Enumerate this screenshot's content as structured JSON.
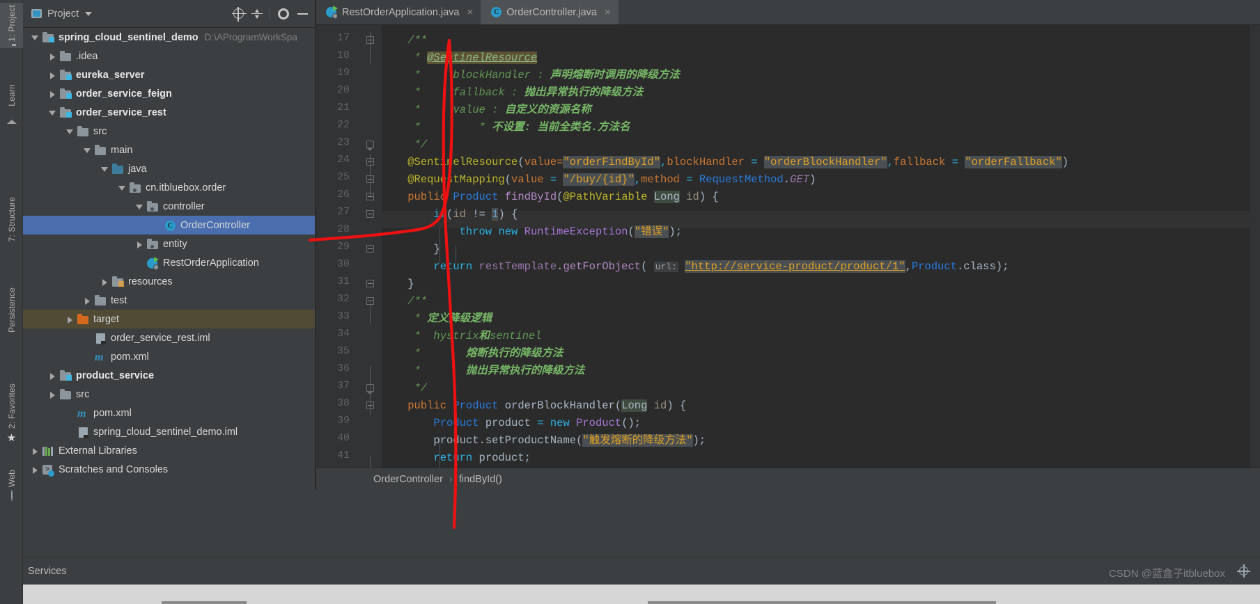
{
  "toolwindow_left": [
    {
      "label": "1: Project",
      "icon": "folder-icon",
      "active": true
    },
    {
      "label": "Learn",
      "icon": "layers-icon",
      "active": false
    },
    {
      "label": "7: Structure",
      "icon": "structure-icon",
      "active": false
    },
    {
      "label": "Persistence",
      "icon": "database-icon",
      "active": false
    },
    {
      "label": "2: Favorites",
      "icon": "star-icon",
      "active": false
    },
    {
      "label": "Web",
      "icon": "globe-icon",
      "active": false
    }
  ],
  "project_header": {
    "title": "Project",
    "caret": "chevron-down-icon",
    "buttons": [
      {
        "name": "scroll-from-source-button",
        "icon": "target-icon"
      },
      {
        "name": "collapse-all-button",
        "icon": "collapse-all-icon"
      },
      {
        "name": "settings-button",
        "icon": "gear-icon"
      },
      {
        "name": "hide-button",
        "icon": "minimize-icon"
      }
    ]
  },
  "tree": [
    {
      "indent": 0,
      "arrow": "open",
      "icon": "module-folder-icon",
      "label": "spring_cloud_sentinel_demo",
      "bold": true,
      "path": "D:\\AProgramWorkSpa",
      "state": "normal"
    },
    {
      "indent": 1,
      "arrow": "closed",
      "icon": "folder-icon",
      "label": ".idea",
      "bold": false,
      "path": "",
      "state": "normal"
    },
    {
      "indent": 1,
      "arrow": "closed",
      "icon": "module-folder-icon",
      "label": "eureka_server",
      "bold": true,
      "path": "",
      "state": "normal"
    },
    {
      "indent": 1,
      "arrow": "closed",
      "icon": "module-folder-icon",
      "label": "order_service_feign",
      "bold": true,
      "path": "",
      "state": "normal"
    },
    {
      "indent": 1,
      "arrow": "open",
      "icon": "module-folder-icon",
      "label": "order_service_rest",
      "bold": true,
      "path": "",
      "state": "normal"
    },
    {
      "indent": 2,
      "arrow": "open",
      "icon": "folder-icon",
      "label": "src",
      "bold": false,
      "path": "",
      "state": "normal"
    },
    {
      "indent": 3,
      "arrow": "open",
      "icon": "folder-icon",
      "label": "main",
      "bold": false,
      "path": "",
      "state": "normal"
    },
    {
      "indent": 4,
      "arrow": "open",
      "icon": "source-folder-icon",
      "label": "java",
      "bold": false,
      "path": "",
      "state": "normal"
    },
    {
      "indent": 5,
      "arrow": "open",
      "icon": "package-icon",
      "label": "cn.itbluebox.order",
      "bold": false,
      "path": "",
      "state": "normal"
    },
    {
      "indent": 6,
      "arrow": "open",
      "icon": "package-icon",
      "label": "controller",
      "bold": false,
      "path": "",
      "state": "normal"
    },
    {
      "indent": 7,
      "arrow": "none",
      "icon": "java-class-icon",
      "label": "OrderController",
      "bold": false,
      "path": "",
      "state": "selected"
    },
    {
      "indent": 6,
      "arrow": "closed",
      "icon": "package-icon",
      "label": "entity",
      "bold": false,
      "path": "",
      "state": "normal"
    },
    {
      "indent": 6,
      "arrow": "none",
      "icon": "spring-boot-icon",
      "label": "RestOrderApplication",
      "bold": false,
      "path": "",
      "state": "normal"
    },
    {
      "indent": 4,
      "arrow": "closed",
      "icon": "resources-folder-icon",
      "label": "resources",
      "bold": false,
      "path": "",
      "state": "normal"
    },
    {
      "indent": 3,
      "arrow": "closed",
      "icon": "folder-icon",
      "label": "test",
      "bold": false,
      "path": "",
      "state": "normal"
    },
    {
      "indent": 2,
      "arrow": "closed",
      "icon": "target-folder-icon",
      "label": "target",
      "bold": false,
      "path": "",
      "state": "highlight"
    },
    {
      "indent": 3,
      "arrow": "none",
      "icon": "iml-file-icon",
      "label": "order_service_rest.iml",
      "bold": false,
      "path": "",
      "state": "normal"
    },
    {
      "indent": 3,
      "arrow": "none",
      "icon": "maven-icon",
      "label": "pom.xml",
      "bold": false,
      "path": "",
      "state": "normal"
    },
    {
      "indent": 1,
      "arrow": "closed",
      "icon": "module-folder-icon",
      "label": "product_service",
      "bold": true,
      "path": "",
      "state": "normal"
    },
    {
      "indent": 1,
      "arrow": "closed",
      "icon": "folder-icon",
      "label": "src",
      "bold": false,
      "path": "",
      "state": "normal"
    },
    {
      "indent": 2,
      "arrow": "none",
      "icon": "maven-icon",
      "label": "pom.xml",
      "bold": false,
      "path": "",
      "state": "normal"
    },
    {
      "indent": 2,
      "arrow": "none",
      "icon": "iml-file-icon",
      "label": "spring_cloud_sentinel_demo.iml",
      "bold": false,
      "path": "",
      "state": "normal"
    },
    {
      "indent": 0,
      "arrow": "closed",
      "icon": "library-icon",
      "label": "External Libraries",
      "bold": false,
      "path": "",
      "state": "normal"
    },
    {
      "indent": 0,
      "arrow": "closed",
      "icon": "scratches-icon",
      "label": "Scratches and Consoles",
      "bold": false,
      "path": "",
      "state": "normal"
    }
  ],
  "editor_tabs": [
    {
      "label": "RestOrderApplication.java",
      "icon": "spring-boot-icon",
      "active": false,
      "close": "×"
    },
    {
      "label": "OrderController.java",
      "icon": "java-class-icon",
      "active": true,
      "close": "×"
    }
  ],
  "code": {
    "first_line_number": 17,
    "lines": [
      {
        "n": 17,
        "fold": "start",
        "tokens": [
          {
            "t": "    /**",
            "c": "c-cmt"
          }
        ]
      },
      {
        "n": 18,
        "fold": "",
        "tokens": [
          {
            "t": "     * ",
            "c": "c-cmt"
          },
          {
            "t": "@SentinelResource",
            "c": "c-tag"
          }
        ]
      },
      {
        "n": 19,
        "fold": "",
        "tokens": [
          {
            "t": "     *     ",
            "c": "c-cmt"
          },
          {
            "t": "blockHandler : ",
            "c": "c-cmt"
          },
          {
            "t": "声明熔断时调用的降级方法",
            "c": "c-cmtb"
          }
        ]
      },
      {
        "n": 20,
        "fold": "",
        "tokens": [
          {
            "t": "     *     ",
            "c": "c-cmt"
          },
          {
            "t": "fallback : ",
            "c": "c-cmt"
          },
          {
            "t": "抛出异常执行的降级方法",
            "c": "c-cmtb"
          }
        ]
      },
      {
        "n": 21,
        "fold": "",
        "tokens": [
          {
            "t": "     *     ",
            "c": "c-cmt"
          },
          {
            "t": "value : ",
            "c": "c-cmt"
          },
          {
            "t": "自定义的资源名称",
            "c": "c-cmtb"
          }
        ]
      },
      {
        "n": 22,
        "fold": "",
        "tokens": [
          {
            "t": "     *         * ",
            "c": "c-cmt"
          },
          {
            "t": "不设置: 当前全类名.方法名",
            "c": "c-cmtb"
          }
        ]
      },
      {
        "n": 23,
        "fold": "end",
        "tokens": [
          {
            "t": "     */",
            "c": "c-cmt"
          }
        ]
      },
      {
        "n": 24,
        "fold": "mark",
        "tokens": [
          {
            "t": "    @SentinelResource",
            "c": "c-anno"
          },
          {
            "t": "(",
            "c": "c-plain"
          },
          {
            "t": "value=",
            "c": "c-kw"
          },
          {
            "t": "\"orderFindById\"",
            "c": "c-strhl"
          },
          {
            "t": ",",
            "c": "c-eq"
          },
          {
            "t": "blockHandler ",
            "c": "c-kw"
          },
          {
            "t": "= ",
            "c": "c-eq"
          },
          {
            "t": "\"orderBlockHandler\"",
            "c": "c-strhl"
          },
          {
            "t": ",",
            "c": "c-eq"
          },
          {
            "t": "fallback ",
            "c": "c-kw"
          },
          {
            "t": "= ",
            "c": "c-eq"
          },
          {
            "t": "\"orderFallback\"",
            "c": "c-strhl"
          },
          {
            "t": ")",
            "c": "c-plain"
          }
        ]
      },
      {
        "n": 25,
        "fold": "mark",
        "tokens": [
          {
            "t": "    @RequestMapping",
            "c": "c-anno"
          },
          {
            "t": "(",
            "c": "c-plain"
          },
          {
            "t": "value ",
            "c": "c-kw"
          },
          {
            "t": "= ",
            "c": "c-eq"
          },
          {
            "t": "\"/buy/{id}\"",
            "c": "c-strhl"
          },
          {
            "t": ",",
            "c": "c-eq"
          },
          {
            "t": "method ",
            "c": "c-kw"
          },
          {
            "t": "= ",
            "c": "c-eq"
          },
          {
            "t": "RequestMethod",
            "c": "c-type"
          },
          {
            "t": ".",
            "c": "c-plain"
          },
          {
            "t": "GET",
            "c": "c-static"
          },
          {
            "t": ")",
            "c": "c-plain"
          }
        ]
      },
      {
        "n": 26,
        "fold": "mark",
        "current": true,
        "tokens": [
          {
            "t": "    public ",
            "c": "c-kw"
          },
          {
            "t": "Product ",
            "c": "c-type"
          },
          {
            "t": "findById",
            "c": "c-meth"
          },
          {
            "t": "(",
            "c": "c-plain"
          },
          {
            "t": "@PathVariable ",
            "c": "c-anno"
          },
          {
            "t": "Long",
            "c": "c-longhl"
          },
          {
            "t": " ",
            "c": "c-plain"
          },
          {
            "t": "id",
            "c": "c-param"
          },
          {
            "t": ") {",
            "c": "c-plain"
          }
        ]
      },
      {
        "n": 27,
        "fold": "mark",
        "tokens": [
          {
            "t": "        if",
            "c": "c-kw2"
          },
          {
            "t": "(",
            "c": "c-plain"
          },
          {
            "t": "id",
            "c": "c-param"
          },
          {
            "t": " != ",
            "c": "c-plain"
          },
          {
            "t": "1",
            "c": "c-num"
          },
          {
            "t": ") {",
            "c": "c-plain"
          }
        ]
      },
      {
        "n": 28,
        "fold": "",
        "tokens": [
          {
            "t": "            throw ",
            "c": "c-kw2"
          },
          {
            "t": "new ",
            "c": "c-kw2"
          },
          {
            "t": "RuntimeException",
            "c": "c-typep"
          },
          {
            "t": "(",
            "c": "c-plain"
          },
          {
            "t": "\"错误\"",
            "c": "c-strhl"
          },
          {
            "t": ");",
            "c": "c-plain"
          }
        ]
      },
      {
        "n": 29,
        "fold": "mark",
        "tokens": [
          {
            "t": "        }",
            "c": "c-plain"
          }
        ]
      },
      {
        "n": 30,
        "fold": "",
        "tokens": [
          {
            "t": "        return ",
            "c": "c-kw2"
          },
          {
            "t": "restTemplate",
            "c": "c-field"
          },
          {
            "t": ".",
            "c": "c-plain"
          },
          {
            "t": "getForObject",
            "c": "c-meth"
          },
          {
            "t": "( ",
            "c": "c-plain"
          },
          {
            "t": "url:",
            "c": "c-hintbg"
          },
          {
            "t": " ",
            "c": "c-plain"
          },
          {
            "t": "\"http://service-product/product/1\"",
            "c": "c-url"
          },
          {
            "t": ",",
            "c": "c-plain"
          },
          {
            "t": "Product",
            "c": "c-type"
          },
          {
            "t": ".",
            "c": "c-plain"
          },
          {
            "t": "class",
            "c": "c-plain"
          },
          {
            "t": ");",
            "c": "c-plain"
          }
        ]
      },
      {
        "n": 31,
        "fold": "mark",
        "tokens": [
          {
            "t": "    }",
            "c": "c-plain"
          }
        ]
      },
      {
        "n": 32,
        "fold": "start",
        "tokens": [
          {
            "t": "    /**",
            "c": "c-cmt"
          }
        ]
      },
      {
        "n": 33,
        "fold": "",
        "tokens": [
          {
            "t": "     * ",
            "c": "c-cmt"
          },
          {
            "t": "定义降级逻辑",
            "c": "c-cmtb"
          }
        ]
      },
      {
        "n": 34,
        "fold": "",
        "tokens": [
          {
            "t": "     *  ",
            "c": "c-cmt"
          },
          {
            "t": "hystrix",
            "c": "c-cmt"
          },
          {
            "t": "和",
            "c": "c-cmtb"
          },
          {
            "t": "sentinel",
            "c": "c-cmt"
          }
        ]
      },
      {
        "n": 35,
        "fold": "",
        "tokens": [
          {
            "t": "     *       ",
            "c": "c-cmt"
          },
          {
            "t": "熔断执行的降级方法",
            "c": "c-cmtb"
          }
        ]
      },
      {
        "n": 36,
        "fold": "",
        "tokens": [
          {
            "t": "     *       ",
            "c": "c-cmt"
          },
          {
            "t": "抛出异常执行的降级方法",
            "c": "c-cmtb"
          }
        ]
      },
      {
        "n": 37,
        "fold": "end",
        "tokens": [
          {
            "t": "     */",
            "c": "c-cmt"
          }
        ]
      },
      {
        "n": 38,
        "fold": "mark",
        "tokens": [
          {
            "t": "    public ",
            "c": "c-kw"
          },
          {
            "t": "Product ",
            "c": "c-type"
          },
          {
            "t": "orderBlockHandler",
            "c": "c-plain"
          },
          {
            "t": "(",
            "c": "c-plain"
          },
          {
            "t": "Long",
            "c": "c-longhl"
          },
          {
            "t": " ",
            "c": "c-plain"
          },
          {
            "t": "id",
            "c": "c-param"
          },
          {
            "t": ") {",
            "c": "c-plain"
          }
        ]
      },
      {
        "n": 39,
        "fold": "",
        "tokens": [
          {
            "t": "        Product ",
            "c": "c-type"
          },
          {
            "t": "product ",
            "c": "c-plain"
          },
          {
            "t": "= ",
            "c": "c-eq"
          },
          {
            "t": "new ",
            "c": "c-kw2"
          },
          {
            "t": "Product",
            "c": "c-typep"
          },
          {
            "t": "();",
            "c": "c-plain"
          }
        ]
      },
      {
        "n": 40,
        "fold": "",
        "tokens": [
          {
            "t": "        product",
            "c": "c-plain"
          },
          {
            "t": ".",
            "c": "c-plain"
          },
          {
            "t": "setProductName",
            "c": "c-plain"
          },
          {
            "t": "(",
            "c": "c-plain"
          },
          {
            "t": "\"触发熔断的降级方法\"",
            "c": "c-strhl"
          },
          {
            "t": ");",
            "c": "c-plain"
          }
        ]
      },
      {
        "n": 41,
        "fold": "",
        "tokens": [
          {
            "t": "        return ",
            "c": "c-kw2"
          },
          {
            "t": "product",
            "c": "c-plain"
          },
          {
            "t": ";",
            "c": "c-plain"
          }
        ]
      }
    ]
  },
  "breadcrumb": {
    "class": "OrderController",
    "separator": "›",
    "method": "findById()"
  },
  "status": {
    "services_label": "Services",
    "watermark": "CSDN @蓝盒子itbluebox"
  },
  "colors": {
    "selection": "#4b6eaf",
    "highlight": "#514b35",
    "annotation": "#ee1111",
    "panel": "#3c3f41",
    "editor_bg": "#2b2b2b"
  }
}
